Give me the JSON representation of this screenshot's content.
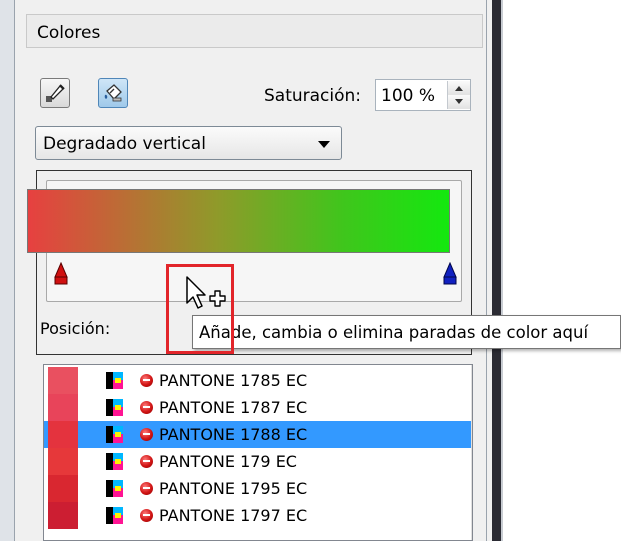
{
  "panel": {
    "title": "Colores",
    "saturation_label": "Saturación:",
    "saturation_value": "100 %",
    "gradient_type": "Degradado vertical",
    "position_label": "Posición:",
    "tooltip": "Añade, cambia o elimina paradas de color aquí",
    "gradient_colors": {
      "start": "#e74040",
      "end": "#14e80f"
    },
    "stop_colors": {
      "left": "#d01010",
      "right": "#1020c0"
    }
  },
  "colors_list": {
    "items": [
      {
        "label": "PANTONE 1785 EC",
        "swatch": "#e95060",
        "selected": false
      },
      {
        "label": "PANTONE 1787 EC",
        "swatch": "#e8445a",
        "selected": false
      },
      {
        "label": "PANTONE 1788 EC",
        "swatch": "#e4333e",
        "selected": true
      },
      {
        "label": "PANTONE 179 EC",
        "swatch": "#e6383a",
        "selected": false
      },
      {
        "label": "PANTONE 1795 EC",
        "swatch": "#d92730",
        "selected": false
      },
      {
        "label": "PANTONE 1797 EC",
        "swatch": "#cc1e32",
        "selected": false
      }
    ]
  }
}
